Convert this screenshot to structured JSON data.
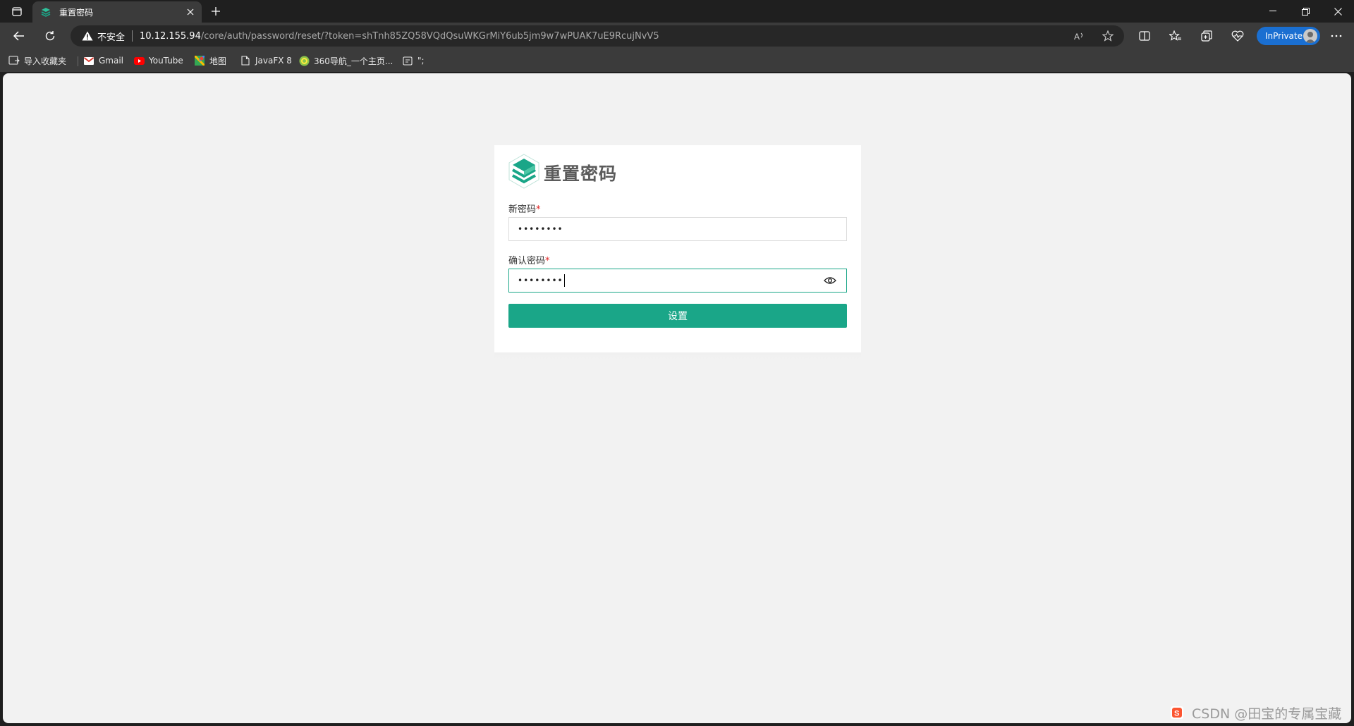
{
  "browser": {
    "tab": {
      "title": "重置密码"
    },
    "address": {
      "security_label": "不安全",
      "host": "10.12.155.94",
      "path": "/core/auth/password/reset/?token=shTnh85ZQ58VQdQsuWKGrMiY6ub5jm9w7wPUAK7uE9RcujNvV5"
    },
    "inprivate_label": "InPrivate",
    "bookmarks": [
      {
        "label": "导入收藏夹",
        "icon": "import-icon"
      },
      {
        "label": "Gmail",
        "icon": "gmail-icon"
      },
      {
        "label": "YouTube",
        "icon": "youtube-icon"
      },
      {
        "label": "地图",
        "icon": "maps-icon"
      },
      {
        "label": "JavaFX 8",
        "icon": "page-icon"
      },
      {
        "label": "360导航_一个主页...",
        "icon": "360-icon"
      },
      {
        "label": "\";",
        "icon": "form-icon"
      }
    ]
  },
  "page": {
    "title": "重置密码",
    "new_password": {
      "label": "新密码",
      "required_mark": "*",
      "value": "••••••••"
    },
    "confirm_password": {
      "label": "确认密码",
      "required_mark": "*",
      "value": "••••••••"
    },
    "submit_label": "设置"
  },
  "watermark": {
    "text": "CSDN @田宝的专属宝藏"
  },
  "colors": {
    "accent": "#1aa688",
    "required": "#e02020",
    "inprivate": "#1a6fd1"
  }
}
